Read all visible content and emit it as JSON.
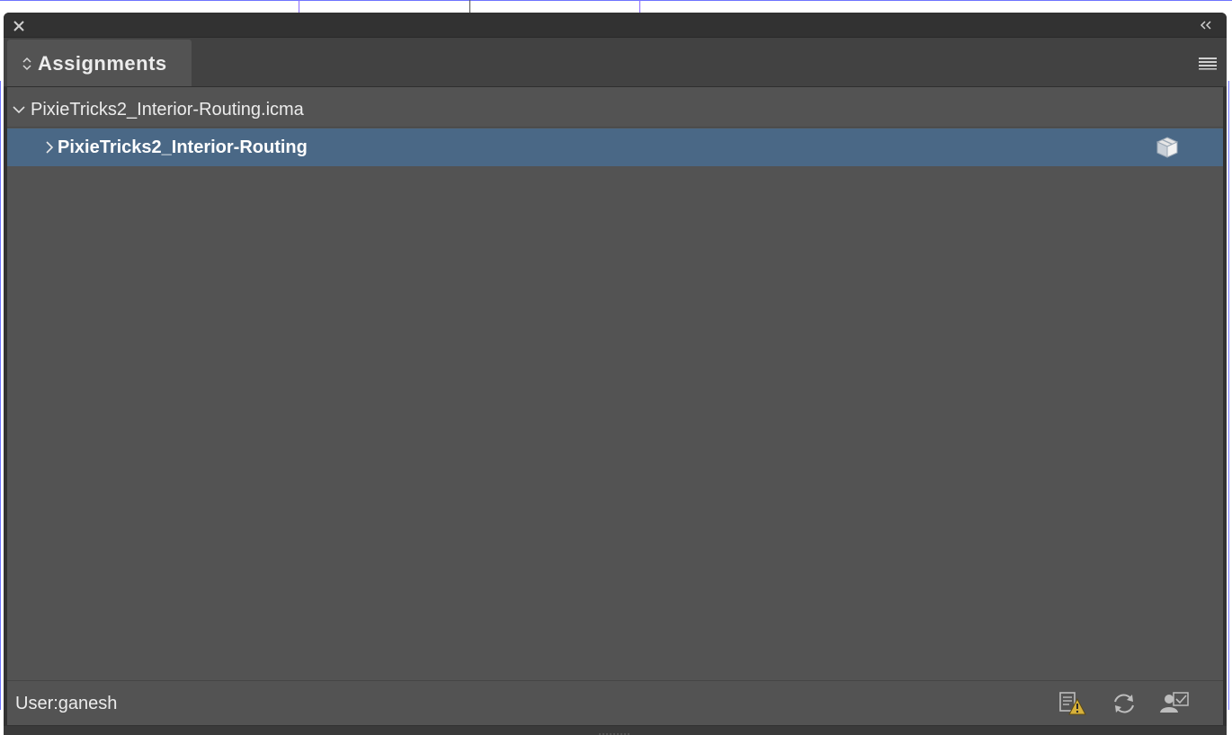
{
  "panel": {
    "title": "Assignments",
    "colors": {
      "panel_dark": "#323232",
      "tab_bar": "#424242",
      "content": "#535353",
      "selection": "#4a6886",
      "guide": "#6f74ff"
    },
    "icons": {
      "close": "close-icon",
      "collapse": "double-chevron-left-icon",
      "tab_sort": "up-down-chevron-icon",
      "menu": "hamburger-menu-icon"
    }
  },
  "tree": {
    "file": {
      "name": "PixieTricks2_Interior-Routing.icma",
      "expanded": true,
      "icon": "chevron-down-icon"
    },
    "assignment": {
      "name": "PixieTricks2_Interior-Routing",
      "expanded": false,
      "selected": true,
      "icon": "chevron-right-icon",
      "status_icon": "package-icon"
    }
  },
  "footer": {
    "user_label": "User:ganesh",
    "buttons": [
      {
        "icon": "document-warning-icon"
      },
      {
        "icon": "refresh-icon"
      },
      {
        "icon": "user-check-icon"
      }
    ]
  }
}
